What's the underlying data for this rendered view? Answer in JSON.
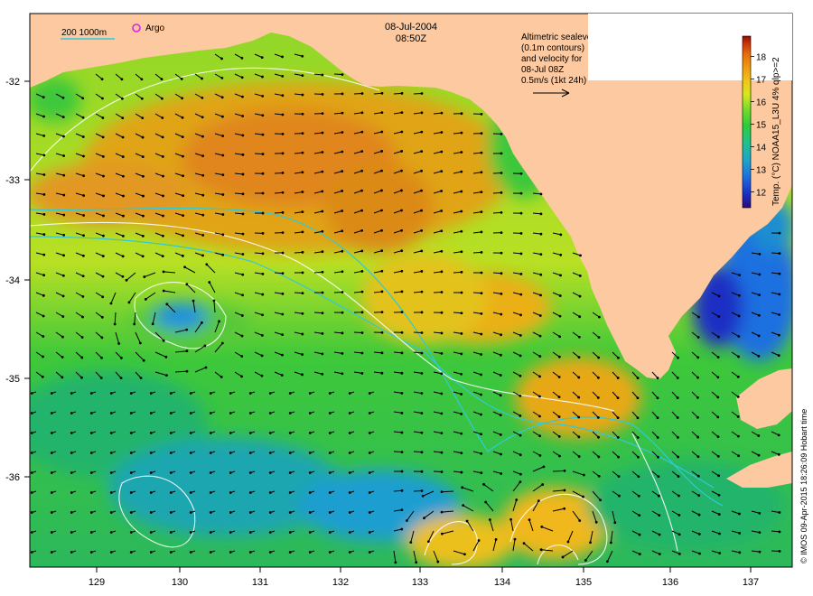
{
  "header": {
    "date": "08-Jul-2004",
    "time": "08:50Z"
  },
  "legend": {
    "isobaths": "200  1000m",
    "argo": "Argo"
  },
  "annotation": {
    "line1": "Altimetric sealevel",
    "line2": "(0.1m contours)",
    "line3": "and velocity for",
    "line4": "08-Jul 08Z",
    "line5": "0.5m/s (1kt 24h)"
  },
  "colorbar": {
    "label": "Temp. (°C) NOAA15_L3U 4% qlp>=2",
    "ticks": [
      "12",
      "13",
      "14",
      "15",
      "16",
      "17",
      "18"
    ],
    "min": 11.3,
    "max": 18.9,
    "colors": [
      "#2a0a78",
      "#1a2fc4",
      "#1e6fe0",
      "#1fa6c8",
      "#22c28a",
      "#2ecc3a",
      "#7edc2a",
      "#d8e81e",
      "#f2c418",
      "#ee9a10",
      "#e36a0a",
      "#c83008",
      "#8a1004"
    ]
  },
  "axes": {
    "x_ticks": [
      "129",
      "130",
      "131",
      "132",
      "133",
      "134",
      "135",
      "136",
      "137"
    ],
    "y_ticks": [
      "-32",
      "-33",
      "-34",
      "-35",
      "-36"
    ]
  },
  "credit": "© IMOS 09-Apr-2015 18:26:09 Hobart time",
  "colors": {
    "land": "#fdc9a0",
    "vector": "#000000",
    "contour": "#ffffff",
    "isobath": "#33c8d8",
    "argo": "#e020e0"
  }
}
